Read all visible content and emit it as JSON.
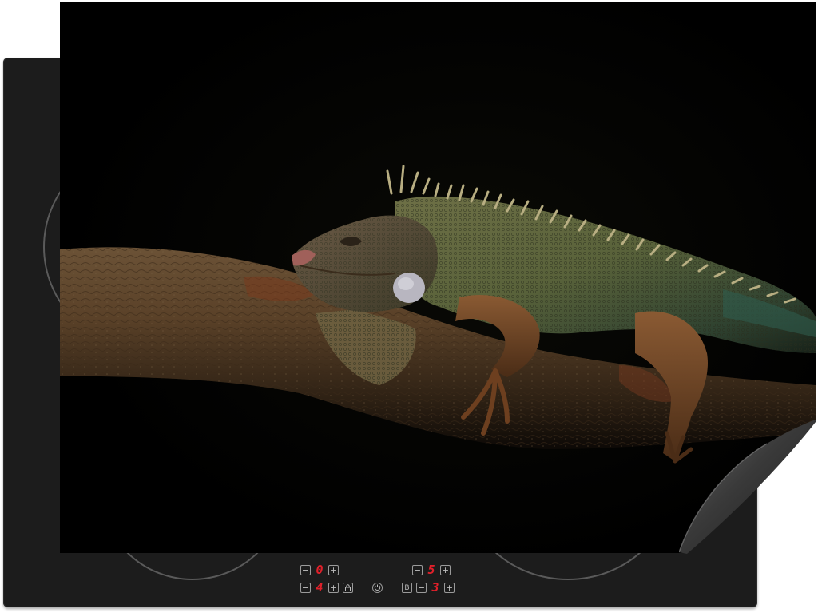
{
  "product": {
    "subject": "iguana-on-branch",
    "colors": {
      "background": "#000000",
      "hob": "#1c1c1c",
      "display_digit": "#e0202a"
    }
  },
  "controls": {
    "zones": [
      {
        "id": "front-left",
        "level": "0"
      },
      {
        "id": "rear-left",
        "level": "4"
      },
      {
        "id": "front-right",
        "level": "5"
      },
      {
        "id": "rear-right",
        "level": "3"
      }
    ],
    "minus_symbol": "−",
    "plus_symbol": "+",
    "booster_label": "B"
  }
}
